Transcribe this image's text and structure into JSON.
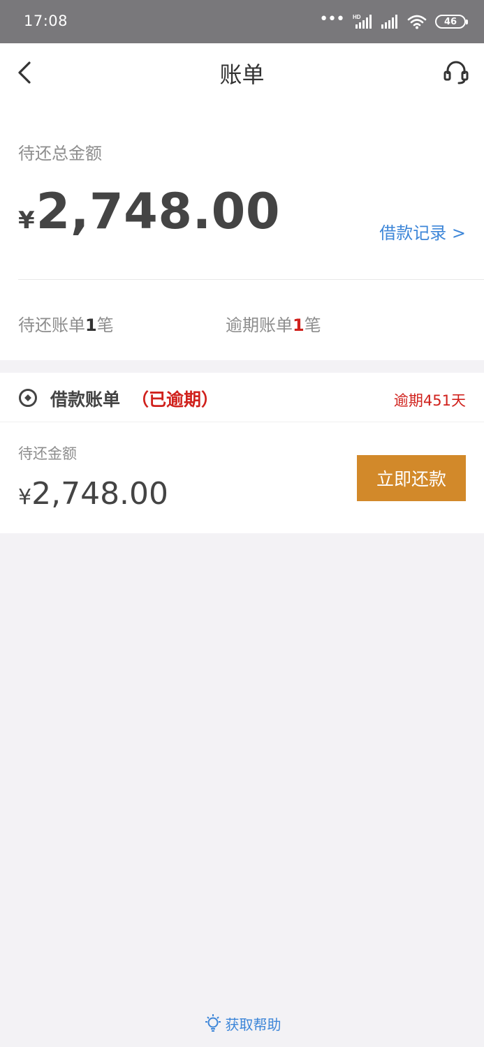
{
  "status_bar": {
    "time": "17:08",
    "battery": "46"
  },
  "header": {
    "title": "账单",
    "back_icon": "chevron-left-icon",
    "service_icon": "headset-icon"
  },
  "summary": {
    "total_label": "待还总金额",
    "currency": "¥",
    "total_amount": "2,748.00",
    "loan_record_link": "借款记录 >",
    "pending_prefix": "待还账单",
    "pending_count": "1",
    "pending_suffix": "笔",
    "overdue_prefix": "逾期账单",
    "overdue_count": "1",
    "overdue_suffix": "笔"
  },
  "bill": {
    "title": "借款账单",
    "status": "（已逾期）",
    "overdue_days": "逾期451天",
    "due_label": "待还金额",
    "currency": "¥",
    "due_amount": "2,748.00",
    "repay_button": "立即还款"
  },
  "help": {
    "label": "获取帮助",
    "icon": "lightbulb-icon"
  },
  "colors": {
    "accent_blue": "#3d86d8",
    "alert_red": "#d0211c",
    "button_orange": "#d2892a",
    "status_bar": "#79787b",
    "page_bg": "#f3f2f5"
  }
}
